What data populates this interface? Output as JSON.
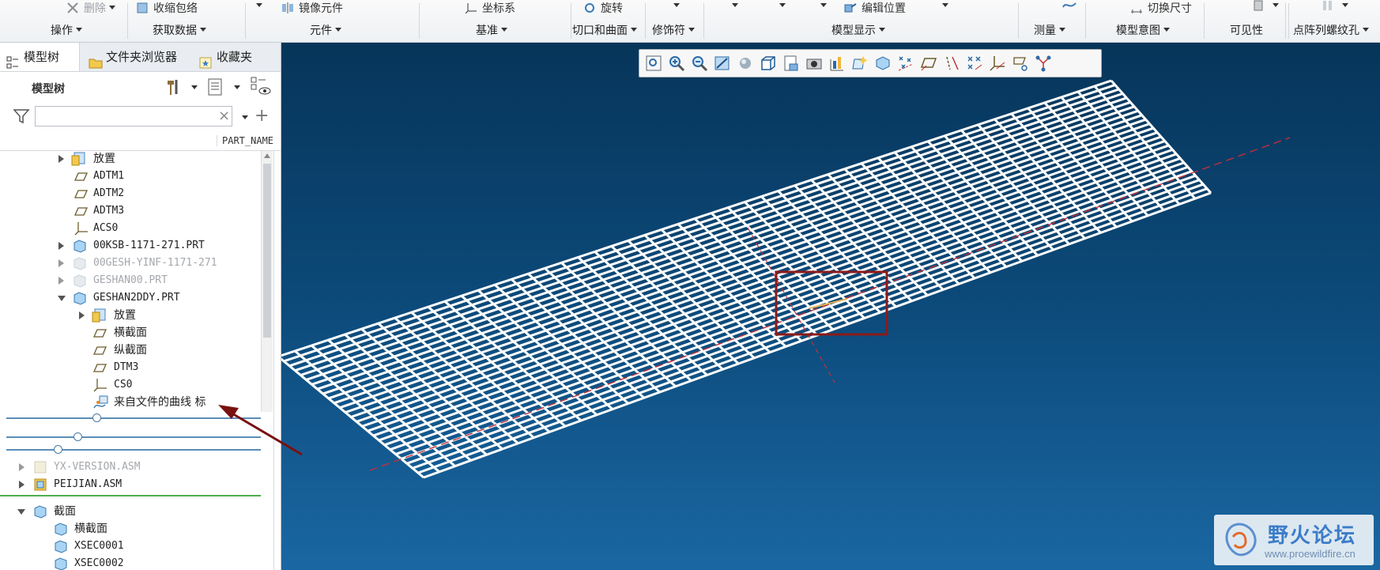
{
  "ribbon": {
    "top_items": [
      "删除",
      "收缩包络",
      "镜像元件",
      "坐标系",
      "旋转",
      "编辑位置",
      "切换尺寸"
    ],
    "groups": [
      "操作",
      "获取数据",
      "元件",
      "基准",
      "切口和曲面",
      "修饰符",
      "模型显示",
      "测量",
      "模型意图",
      "可见性",
      "点阵列螺纹孔"
    ]
  },
  "panel": {
    "tabs": [
      "模型树",
      "文件夹浏览器",
      "收藏夹"
    ],
    "tree_title": "模型树",
    "search": {
      "value": "",
      "placeholder": ""
    },
    "column_header": "PART_NAME",
    "rows": [
      "放置",
      "ADTM1",
      "ADTM2",
      "ADTM3",
      "ACS0",
      "00KSB-1171-271.PRT",
      "00GESH-YINF-1171-271",
      "GESHAN00.PRT",
      "GESHAN2DDY.PRT",
      "放置",
      "横截面",
      "纵截面",
      "DTM3",
      "CS0",
      "来自文件的曲线 标",
      "YX-VERSION.ASM",
      "PEIJIAN.ASM",
      "截面",
      "横截面",
      "XSEC0001",
      "XSEC0002"
    ]
  },
  "colors": {
    "viewport_top": "#07355a",
    "viewport_bottom": "#1a67a3",
    "mesh": "#ffffff",
    "highlight_box": "#8b1a1a",
    "arrow": "#7a1010"
  },
  "watermark": {
    "cn": "野火论坛",
    "url": "www.proewildfire.cn"
  }
}
